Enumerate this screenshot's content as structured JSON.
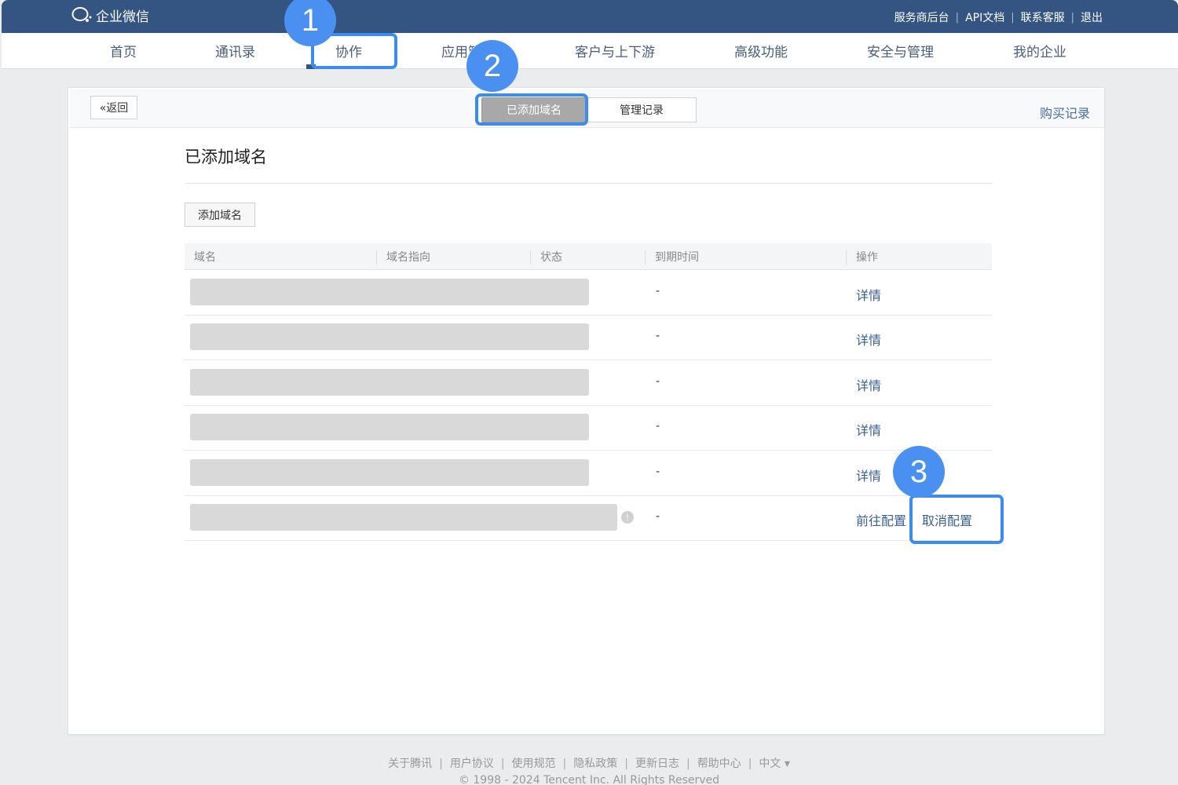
{
  "app": {
    "logo_text": "企业微信"
  },
  "top_links": [
    "服务商后台",
    "API文档",
    "联系客服",
    "退出"
  ],
  "nav": [
    "首页",
    "通讯录",
    "协作",
    "应用管",
    "客户与上下游",
    "高级功能",
    "安全与管理",
    "我的企业"
  ],
  "steps": [
    "1",
    "2",
    "3"
  ],
  "header": {
    "back_label": "«返回",
    "tabs": [
      "已添加域名",
      "管理记录"
    ],
    "active_tab": "已添加域名",
    "buy_record": "购买记录"
  },
  "page_title": "已添加域名",
  "add_button": "添加域名",
  "table": {
    "columns": [
      "域名",
      "域名指向",
      "状态",
      "到期时间",
      "操作"
    ],
    "rows": [
      {
        "domain": "",
        "expiry": "-",
        "actions": [
          "详情"
        ]
      },
      {
        "domain": "",
        "expiry": "-",
        "actions": [
          "详情"
        ]
      },
      {
        "domain": "",
        "expiry": "-",
        "actions": [
          "详情"
        ]
      },
      {
        "domain": "",
        "expiry": "-",
        "actions": [
          "详情"
        ]
      },
      {
        "domain": "",
        "expiry": "-",
        "actions": [
          "详情"
        ]
      },
      {
        "domain": "",
        "expiry": "-",
        "actions": [
          "前往配置",
          "取消配置"
        ]
      }
    ]
  },
  "footer": {
    "links": [
      "关于腾讯",
      "用户协议",
      "使用规范",
      "隐私政策",
      "更新日志",
      "帮助中心",
      "中文 ▾"
    ],
    "copyright": "© 1998 - 2024 Tencent Inc. All Rights Reserved"
  },
  "colors": {
    "topbar": "#345582",
    "highlight": "#3c8cf0",
    "step_badge": "#4a90f0",
    "link": "#3a5f94"
  }
}
